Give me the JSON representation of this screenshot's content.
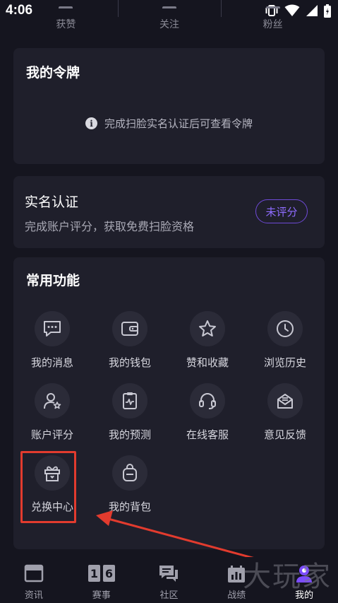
{
  "status_bar": {
    "time": "4:06"
  },
  "profile_stats": [
    {
      "label": "获赞"
    },
    {
      "label": "关注"
    },
    {
      "label": "粉丝"
    }
  ],
  "token_card": {
    "title": "我的令牌",
    "hint": "完成扫脸实名认证后可查看令牌"
  },
  "realname_card": {
    "title": "实名认证",
    "subtitle": "完成账户评分，获取免费扫脸资格",
    "badge": "未评分"
  },
  "functions": {
    "title": "常用功能",
    "items": [
      {
        "label": "我的消息",
        "icon": "message-icon"
      },
      {
        "label": "我的钱包",
        "icon": "wallet-icon"
      },
      {
        "label": "赞和收藏",
        "icon": "star-icon"
      },
      {
        "label": "浏览历史",
        "icon": "clock-icon"
      },
      {
        "label": "账户评分",
        "icon": "user-rating-icon"
      },
      {
        "label": "我的预测",
        "icon": "prediction-icon"
      },
      {
        "label": "在线客服",
        "icon": "headset-icon"
      },
      {
        "label": "意见反馈",
        "icon": "feedback-icon"
      },
      {
        "label": "兑换中心",
        "icon": "gift-icon"
      },
      {
        "label": "我的背包",
        "icon": "backpack-icon"
      }
    ]
  },
  "bottom_nav": [
    {
      "label": "资讯",
      "icon": "news-icon"
    },
    {
      "label": "赛事",
      "icon": "match-icon"
    },
    {
      "label": "社区",
      "icon": "community-icon"
    },
    {
      "label": "战绩",
      "icon": "record-icon"
    },
    {
      "label": "我的",
      "icon": "profile-icon"
    }
  ],
  "colors": {
    "background": "#15151f",
    "card": "#1f1f2b",
    "accent": "#8f6cff",
    "highlight": "#e23b2e"
  }
}
